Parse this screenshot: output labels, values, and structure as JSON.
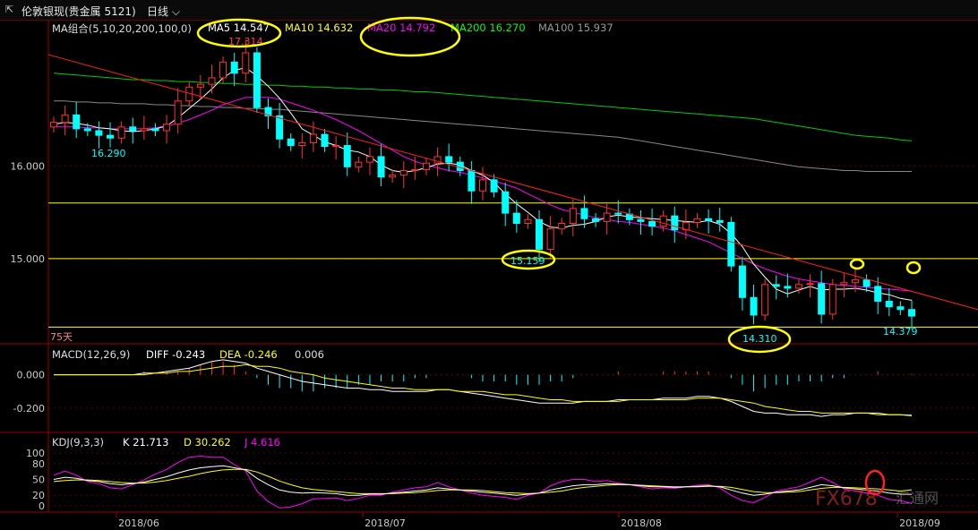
{
  "header": {
    "icon_name": "chart-toggle-icon",
    "title": "伦敦银现(贵金属 5121)",
    "period": "日线",
    "period_icon": "chevron-down-icon"
  },
  "ma_legend": {
    "label": "MA组合(5,10,20,200,100,0)",
    "items": [
      {
        "text": "MA5 14.547",
        "color": "#ffffff"
      },
      {
        "text": "MA10 14.632",
        "color": "#ffff00"
      },
      {
        "text": "MA20 14.792",
        "color": "#ff00ff"
      },
      {
        "text": "MA200 16.270",
        "color": "#00ff00"
      },
      {
        "text": "MA100 15.937",
        "color": "#999999"
      }
    ]
  },
  "price_axis": {
    "ticks": [
      "16.000",
      "15.000"
    ],
    "range": [
      14.1,
      17.5
    ]
  },
  "annotations": {
    "high": "17.314",
    "low_left": "16.290",
    "low_mid": "15.159",
    "low_bottom": "14.310",
    "last": "14.379",
    "horizon": "75天"
  },
  "horizontal_levels": [
    15.6,
    15.0,
    14.26
  ],
  "macd_legend": {
    "label": "MACD(12,26,9)",
    "diff": "DIFF -0.243",
    "dea": "DEA -0.246",
    "macd": "0.006",
    "ticks": [
      "0.000",
      "-0.200"
    ]
  },
  "kdj_legend": {
    "label": "KDJ(9,3,3)",
    "k": "K 21.713",
    "d": "D 30.262",
    "j": "J 4.616",
    "ticks": [
      "100",
      "80",
      "50",
      "20",
      "0"
    ]
  },
  "date_axis": [
    "2018/06",
    "2018/07",
    "2018/08",
    "2018/09"
  ],
  "watermark": "FX678",
  "watermark_cn": "汇通网",
  "colors": {
    "up": "#ff3232",
    "down": "#00ffff",
    "background": "#000000",
    "grid": "#550000"
  },
  "chart_data": {
    "type": "candlestick",
    "title": "伦敦银现(贵金属 5121)",
    "period": "日线",
    "x_start": "2018-05-24",
    "x_end": "2018-09-04",
    "ylim": [
      14.1,
      17.5
    ],
    "close": [
      16.47,
      16.55,
      16.4,
      16.38,
      16.33,
      16.3,
      16.42,
      16.38,
      16.4,
      16.38,
      16.45,
      16.7,
      16.85,
      16.88,
      16.95,
      17.12,
      17.0,
      17.22,
      16.63,
      16.54,
      16.29,
      16.22,
      16.25,
      16.34,
      16.21,
      16.22,
      15.99,
      16.04,
      16.1,
      15.88,
      15.9,
      15.95,
      15.96,
      16.03,
      16.1,
      16.04,
      15.95,
      15.73,
      15.85,
      15.72,
      15.49,
      15.38,
      15.42,
      15.1,
      15.32,
      15.38,
      15.54,
      15.43,
      15.4,
      15.49,
      15.48,
      15.42,
      15.4,
      15.35,
      15.46,
      15.31,
      15.39,
      15.43,
      15.41,
      15.39,
      14.92,
      14.58,
      14.39,
      14.72,
      14.7,
      14.68,
      14.72,
      14.73,
      14.4,
      14.72,
      14.74,
      14.77,
      14.7,
      14.54,
      14.48,
      14.45,
      14.38
    ],
    "ma5": [
      16.45,
      16.47,
      16.46,
      16.44,
      16.41,
      16.4,
      16.38,
      16.37,
      16.38,
      16.4,
      16.43,
      16.52,
      16.62,
      16.72,
      16.83,
      16.95,
      17.03,
      17.06,
      16.97,
      16.86,
      16.73,
      16.57,
      16.4,
      16.33,
      16.26,
      16.22,
      16.17,
      16.15,
      16.1,
      16.01,
      15.95,
      15.93,
      15.95,
      15.98,
      16.02,
      16.03,
      16.01,
      15.95,
      15.9,
      15.82,
      15.7,
      15.59,
      15.5,
      15.4,
      15.34,
      15.33,
      15.36,
      15.37,
      15.4,
      15.45,
      15.47,
      15.45,
      15.44,
      15.43,
      15.42,
      15.41,
      15.4,
      15.39,
      15.41,
      15.37,
      15.27,
      15.13,
      14.94,
      14.8,
      14.67,
      14.62,
      14.66,
      14.7,
      14.66,
      14.67,
      14.67,
      14.68,
      14.66,
      14.63,
      14.61,
      14.57,
      14.55
    ],
    "ma20": [
      16.42,
      16.42,
      16.42,
      16.41,
      16.41,
      16.4,
      16.4,
      16.4,
      16.4,
      16.41,
      16.43,
      16.46,
      16.5,
      16.55,
      16.6,
      16.66,
      16.7,
      16.74,
      16.74,
      16.74,
      16.72,
      16.68,
      16.64,
      16.6,
      16.55,
      16.5,
      16.44,
      16.38,
      16.31,
      16.24,
      16.17,
      16.1,
      16.05,
      16.01,
      15.98,
      15.95,
      15.93,
      15.9,
      15.87,
      15.84,
      15.8,
      15.76,
      15.7,
      15.64,
      15.58,
      15.53,
      15.5,
      15.47,
      15.44,
      15.42,
      15.4,
      15.39,
      15.37,
      15.35,
      15.33,
      15.3,
      15.26,
      15.22,
      15.18,
      15.12,
      15.06,
      15.0,
      14.94,
      14.89,
      14.85,
      14.81,
      14.78,
      14.76,
      14.74,
      14.72,
      14.71,
      14.7,
      14.69,
      14.68,
      14.67,
      14.66,
      14.65
    ],
    "ma200": [
      17.0,
      16.99,
      16.98,
      16.97,
      16.96,
      16.95,
      16.94,
      16.93,
      16.93,
      16.92,
      16.92,
      16.91,
      16.91,
      16.9,
      16.9,
      16.89,
      16.89,
      16.88,
      16.88,
      16.87,
      16.87,
      16.86,
      16.86,
      16.85,
      16.85,
      16.84,
      16.84,
      16.83,
      16.83,
      16.82,
      16.82,
      16.81,
      16.8,
      16.8,
      16.79,
      16.78,
      16.77,
      16.76,
      16.75,
      16.74,
      16.73,
      16.72,
      16.71,
      16.7,
      16.69,
      16.68,
      16.67,
      16.66,
      16.65,
      16.64,
      16.63,
      16.62,
      16.61,
      16.6,
      16.59,
      16.58,
      16.57,
      16.56,
      16.55,
      16.54,
      16.53,
      16.52,
      16.51,
      16.49,
      16.47,
      16.45,
      16.43,
      16.41,
      16.39,
      16.37,
      16.35,
      16.33,
      16.32,
      16.31,
      16.3,
      16.28,
      16.27
    ],
    "ma100": [
      16.7,
      16.7,
      16.69,
      16.69,
      16.68,
      16.68,
      16.67,
      16.67,
      16.67,
      16.66,
      16.66,
      16.65,
      16.65,
      16.64,
      16.64,
      16.63,
      16.63,
      16.62,
      16.62,
      16.61,
      16.61,
      16.6,
      16.59,
      16.58,
      16.57,
      16.56,
      16.55,
      16.54,
      16.53,
      16.52,
      16.51,
      16.5,
      16.49,
      16.48,
      16.47,
      16.46,
      16.45,
      16.44,
      16.43,
      16.42,
      16.41,
      16.4,
      16.39,
      16.38,
      16.37,
      16.36,
      16.35,
      16.34,
      16.33,
      16.32,
      16.31,
      16.29,
      16.27,
      16.25,
      16.23,
      16.21,
      16.19,
      16.17,
      16.15,
      16.13,
      16.11,
      16.09,
      16.07,
      16.05,
      16.03,
      16.01,
      15.99,
      15.98,
      15.97,
      15.96,
      15.95,
      15.95,
      15.94,
      15.94,
      15.94,
      15.94,
      15.94
    ],
    "macd_ticks": [
      0.0,
      -0.2
    ],
    "macd_range": [
      -0.33,
      0.1
    ],
    "diff": [
      0.0,
      0.0,
      0.0,
      0.0,
      0.0,
      0.0,
      0.0,
      0.0,
      0.01,
      0.01,
      0.02,
      0.03,
      0.04,
      0.06,
      0.08,
      0.09,
      0.08,
      0.07,
      0.04,
      0.02,
      0.0,
      -0.02,
      -0.04,
      -0.05,
      -0.06,
      -0.07,
      -0.08,
      -0.08,
      -0.09,
      -0.09,
      -0.1,
      -0.1,
      -0.1,
      -0.1,
      -0.09,
      -0.09,
      -0.1,
      -0.11,
      -0.12,
      -0.13,
      -0.14,
      -0.15,
      -0.16,
      -0.17,
      -0.17,
      -0.17,
      -0.17,
      -0.16,
      -0.16,
      -0.16,
      -0.15,
      -0.15,
      -0.15,
      -0.15,
      -0.14,
      -0.14,
      -0.14,
      -0.13,
      -0.13,
      -0.14,
      -0.16,
      -0.19,
      -0.22,
      -0.23,
      -0.23,
      -0.24,
      -0.24,
      -0.24,
      -0.25,
      -0.24,
      -0.24,
      -0.23,
      -0.23,
      -0.23,
      -0.24,
      -0.24,
      -0.243
    ],
    "dea": [
      0.0,
      0.0,
      0.0,
      0.0,
      0.0,
      0.0,
      0.0,
      0.0,
      0.0,
      0.01,
      0.01,
      0.02,
      0.02,
      0.03,
      0.04,
      0.05,
      0.05,
      0.06,
      0.05,
      0.05,
      0.04,
      0.02,
      0.01,
      0.0,
      -0.02,
      -0.03,
      -0.04,
      -0.05,
      -0.06,
      -0.07,
      -0.08,
      -0.08,
      -0.09,
      -0.09,
      -0.09,
      -0.09,
      -0.1,
      -0.1,
      -0.1,
      -0.11,
      -0.12,
      -0.12,
      -0.13,
      -0.14,
      -0.15,
      -0.15,
      -0.16,
      -0.16,
      -0.16,
      -0.16,
      -0.16,
      -0.15,
      -0.15,
      -0.15,
      -0.15,
      -0.15,
      -0.15,
      -0.14,
      -0.14,
      -0.14,
      -0.15,
      -0.16,
      -0.17,
      -0.19,
      -0.2,
      -0.21,
      -0.22,
      -0.22,
      -0.23,
      -0.23,
      -0.23,
      -0.23,
      -0.23,
      -0.24,
      -0.24,
      -0.24,
      -0.246
    ],
    "k": [
      50,
      54,
      52,
      48,
      46,
      42,
      40,
      42,
      45,
      50,
      55,
      62,
      68,
      72,
      74,
      76,
      72,
      68,
      52,
      40,
      30,
      26,
      24,
      25,
      24,
      23,
      20,
      20,
      22,
      22,
      24,
      26,
      28,
      30,
      34,
      32,
      30,
      28,
      26,
      24,
      22,
      20,
      22,
      24,
      30,
      34,
      38,
      40,
      40,
      42,
      41,
      40,
      38,
      36,
      36,
      35,
      36,
      37,
      38,
      36,
      30,
      24,
      20,
      22,
      26,
      28,
      30,
      35,
      40,
      38,
      34,
      32,
      30,
      28,
      24,
      22,
      21.7
    ],
    "d": [
      46,
      48,
      49,
      49,
      48,
      46,
      44,
      43,
      43,
      45,
      48,
      52,
      56,
      61,
      65,
      68,
      69,
      69,
      64,
      56,
      47,
      40,
      34,
      31,
      29,
      27,
      25,
      23,
      23,
      23,
      23,
      24,
      25,
      27,
      29,
      30,
      30,
      30,
      29,
      27,
      25,
      24,
      23,
      24,
      26,
      28,
      32,
      35,
      37,
      39,
      40,
      40,
      39,
      38,
      37,
      36,
      36,
      36,
      37,
      37,
      35,
      31,
      27,
      25,
      25,
      26,
      27,
      30,
      33,
      35,
      35,
      34,
      33,
      32,
      30,
      28,
      30.3
    ],
    "j": [
      58,
      66,
      58,
      46,
      42,
      34,
      32,
      40,
      49,
      60,
      69,
      82,
      92,
      94,
      92,
      92,
      78,
      66,
      28,
      8,
      -4,
      -2,
      4,
      13,
      14,
      15,
      10,
      14,
      20,
      20,
      26,
      30,
      34,
      36,
      44,
      36,
      30,
      24,
      20,
      18,
      16,
      12,
      20,
      24,
      38,
      46,
      50,
      50,
      46,
      48,
      43,
      40,
      36,
      32,
      34,
      33,
      36,
      39,
      40,
      34,
      20,
      10,
      6,
      16,
      28,
      32,
      36,
      45,
      54,
      44,
      32,
      28,
      24,
      20,
      12,
      10,
      4.6
    ],
    "resistance_line": {
      "from": {
        "x": "2018-05-24",
        "y": 17.2
      },
      "to": {
        "x": "2018-09-04",
        "y": 14.8
      }
    }
  }
}
